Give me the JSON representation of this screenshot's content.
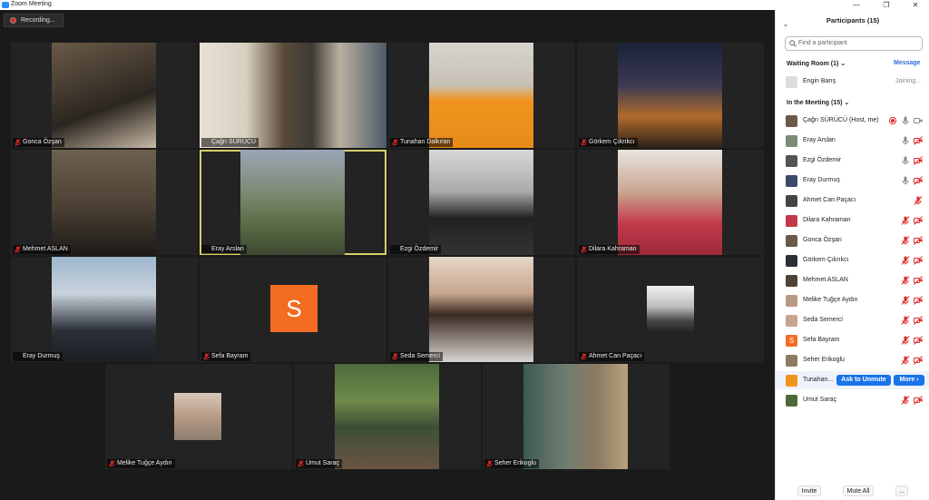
{
  "window": {
    "title": "Zoom Meeting",
    "minimize": "—",
    "restore": "❐",
    "close": "✕"
  },
  "recording": {
    "label": "Recording..."
  },
  "tiles": [
    {
      "name": "Gonca Özşan",
      "muted": true
    },
    {
      "name": "Çağrı SÜRÜCÜ",
      "muted": false
    },
    {
      "name": "Tunahan Dalkıran",
      "muted": true
    },
    {
      "name": "Görkem Çıkrıkcı",
      "muted": true
    },
    {
      "name": "Mehmet ASLAN",
      "muted": true
    },
    {
      "name": "Eray Arslan",
      "muted": false,
      "active": true
    },
    {
      "name": "Ezgi Özdemir",
      "muted": false
    },
    {
      "name": "Dilara Kahraman",
      "muted": true
    },
    {
      "name": "Eray Durmuş",
      "muted": false
    },
    {
      "name": "Sefa Bayram",
      "muted": true,
      "initial": "S"
    },
    {
      "name": "Seda Semerci",
      "muted": true
    },
    {
      "name": "Ahmet Can Paçacı",
      "muted": true
    },
    {
      "name": "Melike Tuğçe Aydın",
      "muted": true
    },
    {
      "name": "Umut Saraç",
      "muted": true
    },
    {
      "name": "Seher Erikoglu",
      "muted": true
    }
  ],
  "panel": {
    "title": "Participants (15)",
    "search_placeholder": "Find a participant",
    "waiting_room": {
      "label": "Waiting Room (1)",
      "message_label": "Message",
      "people": [
        {
          "name": "Engin Barış",
          "status": "Joining..."
        }
      ]
    },
    "in_meeting_label": "In the Meeting (15)",
    "people": [
      {
        "name": "Çağrı SÜRÜCÜ (Host, me)",
        "mic": "on",
        "video": "on",
        "recording": true
      },
      {
        "name": "Eray Arslan",
        "mic": "on",
        "video": "off"
      },
      {
        "name": "Ezgi Özdemir",
        "mic": "on",
        "video": "off"
      },
      {
        "name": "Eray Durmuş",
        "mic": "on",
        "video": "off"
      },
      {
        "name": "Ahmet Can Paçacı",
        "mic": "off",
        "video": "none"
      },
      {
        "name": "Dilara Kahraman",
        "mic": "off",
        "video": "off"
      },
      {
        "name": "Gonca Özşan",
        "mic": "off",
        "video": "off"
      },
      {
        "name": "Görkem Çıkrıkcı",
        "mic": "off",
        "video": "off"
      },
      {
        "name": "Mehmet ASLAN",
        "mic": "off",
        "video": "off"
      },
      {
        "name": "Melike Tuğçe Aydın",
        "mic": "off",
        "video": "off"
      },
      {
        "name": "Seda Semerci",
        "mic": "off",
        "video": "off"
      },
      {
        "name": "Sefa Bayram",
        "mic": "off",
        "video": "off",
        "initial": "S"
      },
      {
        "name": "Seher Erikoglu",
        "mic": "off",
        "video": "off"
      },
      {
        "name": "Tunahan...",
        "hover": true,
        "ask_unmute": "Ask to Unmute",
        "more": "More ›"
      },
      {
        "name": "Umut Saraç",
        "mic": "off",
        "video": "off"
      }
    ],
    "footer": {
      "invite": "Invite",
      "mute_all": "Mute All",
      "more": "..."
    }
  },
  "colors": {
    "accent": "#2d8cff",
    "muted_red": "#e02828",
    "active_speaker": "#d6d06a",
    "avatar_orange": "#f26d21"
  }
}
